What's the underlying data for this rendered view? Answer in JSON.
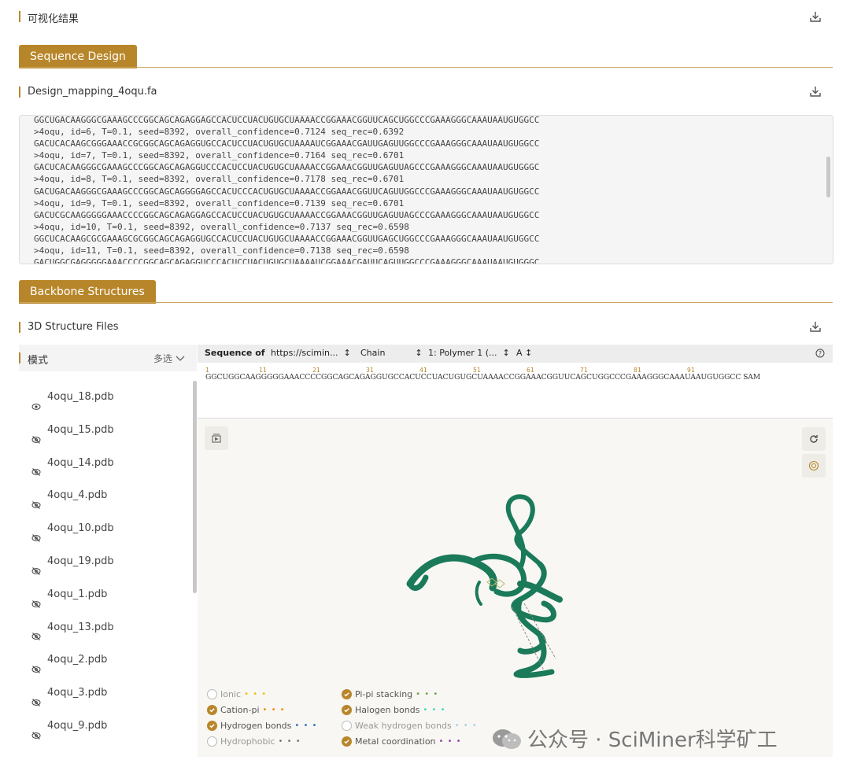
{
  "header": {
    "title": "可视化结果"
  },
  "seq_design": {
    "banner": "Sequence Design",
    "file_title": "Design_mapping_4oqu.fa",
    "lines": [
      "GGCUGACAAGGGCGAAAGCCCGGCAGCAGAGGAGCCACUCCUACUGUGCUAAAACCGGAAACGGUUCAGCUGGCCCGAAAGGGCAAAUAAUGUGGCC",
      ">4oqu, id=6, T=0.1, seed=8392, overall_confidence=0.7124 seq_rec=0.6392",
      "GACUCACAAGCGGGAAACCGCGGCAGCAGAGGUGCCACUCCUACUGUGCUAAAAUCGGAAACGAUUGAGUUGGCCCGAAAGGGCAAAUAAUGUGGCC",
      ">4oqu, id=7, T=0.1, seed=8392, overall_confidence=0.7164 seq_rec=0.6701",
      "GACUCACAAGGGCGAAAGCCCGGCAGCAGAGGUCCCACUCCUACUGUGCUAAAACCGGAAACGGUUGAGUUAGCCCGAAAGGGCAAAUAAUGUGGGC",
      ">4oqu, id=8, T=0.1, seed=8392, overall_confidence=0.7178 seq_rec=0.6701",
      "GACUGACAAGGGCGAAAGCCCGGCAGCAGGGGAGCCACUCCCACUGUGCUAAAACCGGAAACGGUUCAGUUGGCCCGAAAGGGCAAAUAAUGUGGCC",
      ">4oqu, id=9, T=0.1, seed=8392, overall_confidence=0.7139 seq_rec=0.6701",
      "GACUCGCAAGGGGGAAACCCCGGCAGCAGAGGAGCCACUCCUACUGUGCUAAAACCGGAAACGGUUGAGUUAGCCCGAAAGGGCAAAUAAUGUGGCC",
      ">4oqu, id=10, T=0.1, seed=8392, overall_confidence=0.7137 seq_rec=0.6598",
      "GGCUCACAAGCGCGAAAGCGCGGCAGCAGAGGUGCCACUCCUACUGUGCUAAAACCGGAAACGGUUGAGCUGGCCCGAAAGGGCAAAUAAUGUGGCC",
      ">4oqu, id=11, T=0.1, seed=8392, overall_confidence=0.7138 seq_rec=0.6598",
      "GACUGGCGAGGGGGAAACCCCGGCAGCAGAGGUCCCACUCCUACUGUGCUAAAAUCGGAAACGAUUCAGUUGGCCCGAAAGGGCAAAUAAUGUGGGC"
    ]
  },
  "backbone": {
    "banner": "Backbone Structures",
    "file_title": "3D Structure Files"
  },
  "mode_panel": {
    "label": "模式",
    "multi_select": "多选",
    "files": [
      "4oqu_18.pdb",
      "4oqu_15.pdb",
      "4oqu_14.pdb",
      "4oqu_4.pdb",
      "4oqu_10.pdb",
      "4oqu_19.pdb",
      "4oqu_1.pdb",
      "4oqu_13.pdb",
      "4oqu_2.pdb",
      "4oqu_3.pdb",
      "4oqu_9.pdb"
    ],
    "visible_file": "4oqu_18.pdb"
  },
  "sequence_bar": {
    "label": "Sequence of",
    "source": "https://scimin...",
    "chain_label": "Chain",
    "polymer": "1: Polymer 1 (...",
    "chain_id": "A",
    "ticks": [
      "1",
      "11",
      "21",
      "31",
      "41",
      "51",
      "61",
      "71",
      "81",
      "91"
    ],
    "sequence": "GGCUGGCAAGGGGGAAACCCCGGCAGCAGAGGUGCCACUCCUACUGUGCUAAAACCGGAAACGGUUCAGCUGGCCCGAAAGGGCAAAUAAUGUGGCC SAM"
  },
  "legend": [
    {
      "label": "Ionic",
      "checked": false,
      "color": "#f0c000"
    },
    {
      "label": "Cation-pi",
      "checked": true,
      "color": "#f08c00"
    },
    {
      "label": "Hydrogen bonds",
      "checked": true,
      "color": "#2a6fbf"
    },
    {
      "label": "Hydrophobic",
      "checked": false,
      "color": "#777777"
    },
    {
      "label": "Pi-pi stacking",
      "checked": true,
      "color": "#6da24b"
    },
    {
      "label": "Halogen bonds",
      "checked": true,
      "color": "#38d9c4"
    },
    {
      "label": "Weak hydrogen bonds",
      "checked": false,
      "color": "#a8cfe8"
    },
    {
      "label": "Metal coordination",
      "checked": true,
      "color": "#8e44ad"
    }
  ],
  "watermark": "公众号 · SciMiner科学矿工",
  "colors": {
    "accent": "#b8862a",
    "structure": "#1a7a5a"
  }
}
